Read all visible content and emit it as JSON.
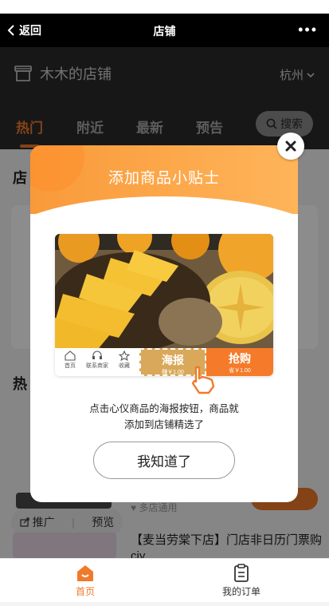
{
  "nav": {
    "back_label": "返回",
    "title": "店铺",
    "more": "•••"
  },
  "store": {
    "name": "木木的店铺",
    "city": "杭州"
  },
  "tabs": [
    {
      "label": "热门",
      "active": true
    },
    {
      "label": "附近",
      "active": false
    },
    {
      "label": "最新",
      "active": false
    },
    {
      "label": "预告",
      "active": false
    }
  ],
  "search": {
    "label": "搜索"
  },
  "background": {
    "section_store": "店",
    "section_hot": "热",
    "promo_label": "推广",
    "preview_label": "预览",
    "shops_text": "多店通用",
    "item_title": "【麦当劳棠下店】门店非日历门票购ciy"
  },
  "modal": {
    "title": "添加商品小贴士",
    "poster": {
      "home_label": "首页",
      "contact_label": "联系商家",
      "favorite_label": "收藏",
      "poster_label": "海报",
      "poster_price": "赚￥1.00",
      "buy_label": "抢购",
      "buy_price": "省￥1.00"
    },
    "tip_line1": "点击心仪商品的海报按钮，商品就",
    "tip_line2": "添加到店铺精选了",
    "confirm_label": "我知道了"
  },
  "tabbar": [
    {
      "label": "首页",
      "icon": "home-icon",
      "active": true
    },
    {
      "label": "我的订单",
      "icon": "order-icon",
      "active": false
    }
  ],
  "colors": {
    "accent": "#f07a2a",
    "poster_gold": "#d9a85a",
    "header_orange": "#f99a3a"
  }
}
